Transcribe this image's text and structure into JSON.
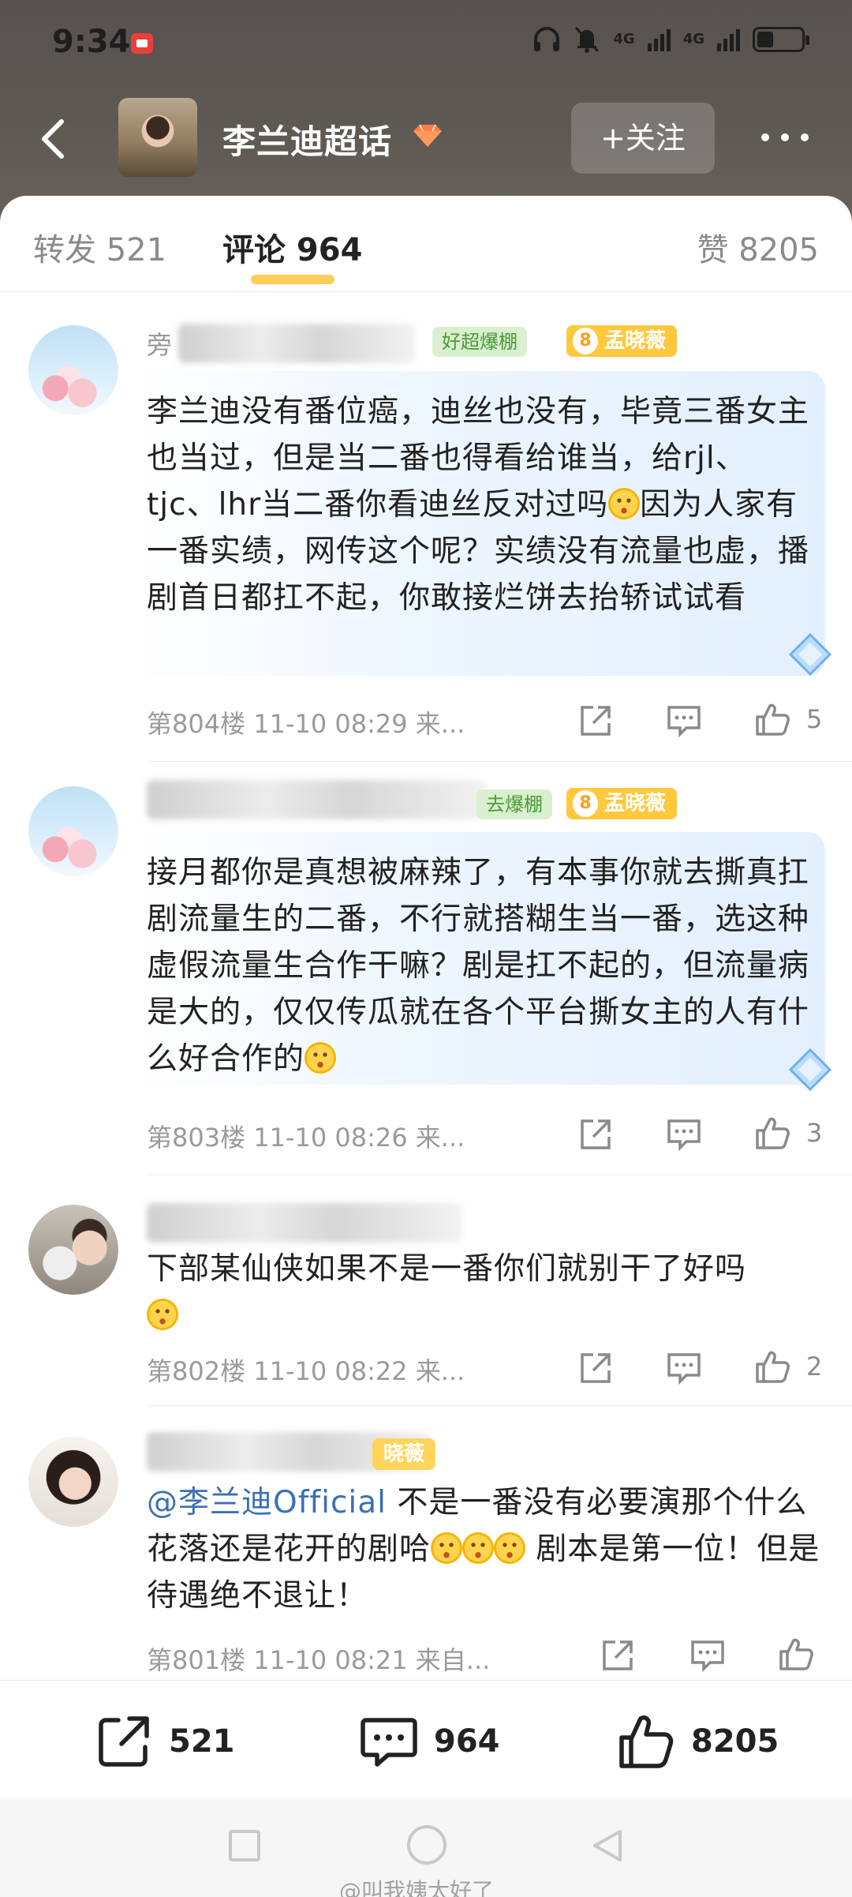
{
  "status_bar": {
    "time": "9:34",
    "signal1": "4G",
    "signal2": "4G"
  },
  "navbar": {
    "title": "李兰迪超话",
    "follow_label": "+关注"
  },
  "tabs": [
    {
      "label": "转发 521"
    },
    {
      "label": "评论 964"
    },
    {
      "label": "赞 8205"
    }
  ],
  "comments": [
    {
      "name_visible": "旁",
      "fan_badge": "好超爆棚",
      "level": "8",
      "level_name": "孟晓薇",
      "text": "李兰迪没有番位癌，迪丝也没有，毕竟三番女主也当过，但是当二番也得看给谁当，给rjl、tjc、lhr当二番你看迪丝反对过吗",
      "text2": "因为人家有一番实绩，网传这个呢？实绩没有流量也虚，播剧首日都扛不起，你敢接烂饼去抬轿试试看",
      "meta": "第804楼 11-10 08:29 来...",
      "likes": "5"
    },
    {
      "fan_badge": "去爆棚",
      "level": "8",
      "level_name": "孟晓薇",
      "text": "接月都你是真想被麻辣了，有本事你就去撕真扛剧流量生的二番，不行就搭糊生当一番，选这种虚假流量生合作干嘛？剧是扛不起的，但流量病是大的，仅仅传瓜就在各个平台撕女主的人有什么好合作的",
      "meta": "第803楼 11-10 08:26 来...",
      "likes": "3"
    },
    {
      "text": "下部某仙侠如果不是一番你们就别干了好吗",
      "meta": "第802楼 11-10 08:22 来...",
      "likes": "2"
    },
    {
      "level_name": "晓薇",
      "mention": "@李兰迪Official",
      "text": " 不是一番没有必要演那个什么花落还是花开的剧哈",
      "text2": " 剧本是第一位！但是待遇绝不退让！",
      "meta": "第801楼 11-10 08:21 来自..."
    }
  ],
  "action_bar": {
    "forward": "521",
    "comment": "964",
    "like": "8205"
  },
  "watermark": "@叫我姨太好了",
  "colors": {
    "accent": "#ffc53d",
    "mention": "#3b6fb6",
    "fan_badge": "#d8f0cf",
    "level_badge": "#ffc83d"
  }
}
